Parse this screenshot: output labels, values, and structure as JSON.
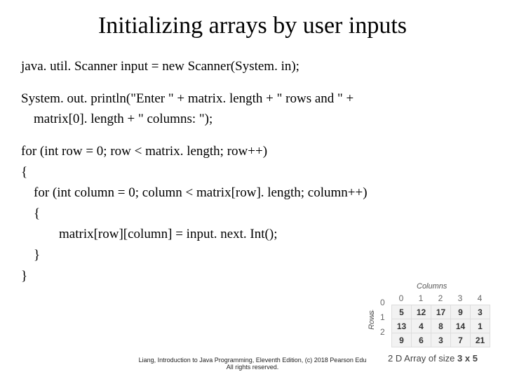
{
  "title": "Initializing arrays by user inputs",
  "code": {
    "l1": "java. util. Scanner input = new Scanner(System. in);",
    "l2": "System. out. println(\"Enter \" + matrix. length + \" rows and \" +",
    "l2b": "matrix[0]. length + \" columns: \");",
    "l3": "for (int row = 0; row < matrix. length; row++)",
    "l4": "{",
    "l5": "for (int column = 0; column < matrix[row]. length; column++)",
    "l6": "{",
    "l7": "matrix[row][column] = input. next. Int();",
    "l8": "}",
    "l9": "}"
  },
  "footer": {
    "l1": "Liang, Introduction to Java Programming, Eleventh Edition, (c) 2018 Pearson Edu",
    "l2": "All rights reserved."
  },
  "diagram": {
    "columns_label": "Columns",
    "rows_label": "Rows",
    "col_heads": [
      "0",
      "1",
      "2",
      "3",
      "4"
    ],
    "row_heads": [
      "0",
      "1",
      "2"
    ],
    "data": [
      [
        "5",
        "12",
        "17",
        "9",
        "3"
      ],
      [
        "13",
        "4",
        "8",
        "14",
        "1"
      ],
      [
        "9",
        "6",
        "3",
        "7",
        "21"
      ]
    ],
    "caption_a": "2 D Array of size ",
    "caption_b": "3 x 5"
  },
  "chart_data": {
    "type": "table",
    "title": "2D Array of size 3 x 5",
    "col_headers": [
      "0",
      "1",
      "2",
      "3",
      "4"
    ],
    "row_headers": [
      "0",
      "1",
      "2"
    ],
    "values": [
      [
        5,
        12,
        17,
        9,
        3
      ],
      [
        13,
        4,
        8,
        14,
        1
      ],
      [
        9,
        6,
        3,
        7,
        21
      ]
    ]
  }
}
